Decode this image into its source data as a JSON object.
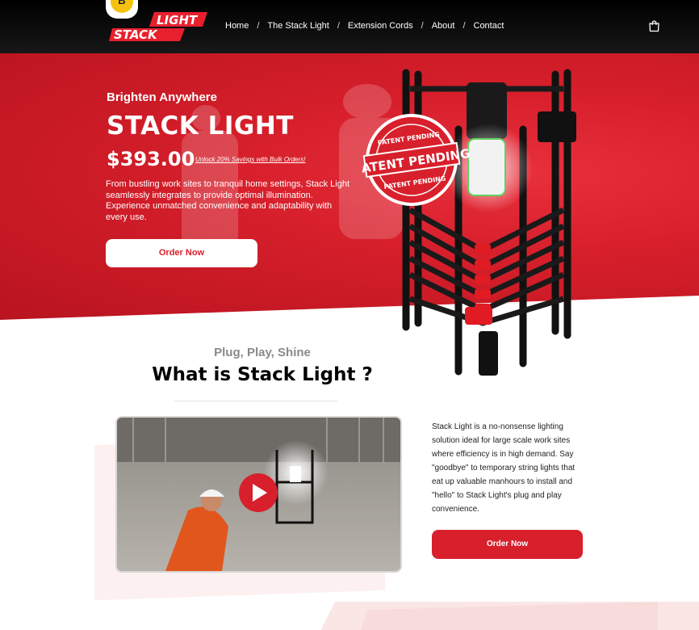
{
  "badge": {
    "letter": "B"
  },
  "logo": {
    "top": "LIGHT",
    "bottom": "STACK"
  },
  "nav": {
    "items": [
      {
        "label": "Home"
      },
      {
        "label": "The Stack Light"
      },
      {
        "label": "Extension Cords"
      },
      {
        "label": "About"
      },
      {
        "label": "Contact"
      }
    ],
    "separator": "/"
  },
  "hero": {
    "tagline": "Brighten Anywhere",
    "title": "STACK LIGHT",
    "price": "$393.00",
    "promo": "Unlock 20% Savings with Bulk Orders!",
    "description": "From bustling work sites to tranquil home settings, Stack Light seamlessly integrates to provide optimal illumination. Experience unmatched convenience and adaptability with every use.",
    "cta": "Order Now",
    "stamp": {
      "main": "PATENT PENDING",
      "ring_top": "PATENT PENDING",
      "ring_bottom": "PATENT PENDING"
    }
  },
  "section": {
    "kicker": "Plug, Play, Shine",
    "heading": "What is Stack Light ?",
    "body": "Stack Light is a no-nonsense lighting solution ideal for large scale work sites where efficiency is in high demand. Say \"goodbye\" to temporary string lights that eat up valuable manhours to install and \"hello\" to Stack Light's plug and play convenience.",
    "cta": "Order Now"
  },
  "colors": {
    "brand_red": "#d8202c",
    "header_bg": "#000000",
    "accent_yellow": "#f4c20d"
  },
  "icons": {
    "cart": "shopping-bag-icon",
    "video": "play-icon"
  }
}
